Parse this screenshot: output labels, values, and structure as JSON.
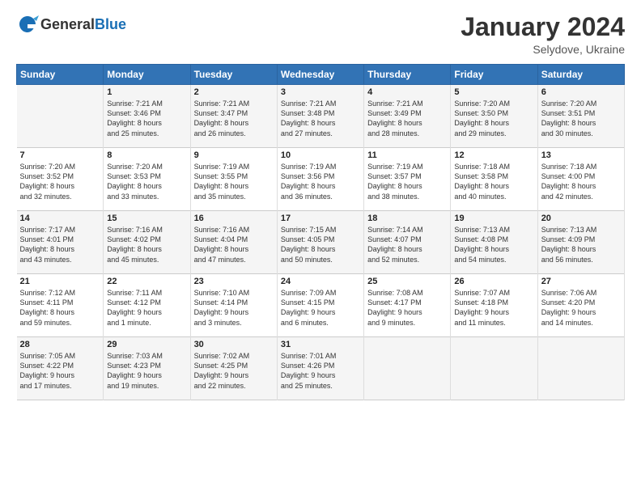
{
  "header": {
    "logo_general": "General",
    "logo_blue": "Blue",
    "month_title": "January 2024",
    "location": "Selydove, Ukraine"
  },
  "days_of_week": [
    "Sunday",
    "Monday",
    "Tuesday",
    "Wednesday",
    "Thursday",
    "Friday",
    "Saturday"
  ],
  "weeks": [
    [
      {
        "day": "",
        "info": ""
      },
      {
        "day": "1",
        "info": "Sunrise: 7:21 AM\nSunset: 3:46 PM\nDaylight: 8 hours\nand 25 minutes."
      },
      {
        "day": "2",
        "info": "Sunrise: 7:21 AM\nSunset: 3:47 PM\nDaylight: 8 hours\nand 26 minutes."
      },
      {
        "day": "3",
        "info": "Sunrise: 7:21 AM\nSunset: 3:48 PM\nDaylight: 8 hours\nand 27 minutes."
      },
      {
        "day": "4",
        "info": "Sunrise: 7:21 AM\nSunset: 3:49 PM\nDaylight: 8 hours\nand 28 minutes."
      },
      {
        "day": "5",
        "info": "Sunrise: 7:20 AM\nSunset: 3:50 PM\nDaylight: 8 hours\nand 29 minutes."
      },
      {
        "day": "6",
        "info": "Sunrise: 7:20 AM\nSunset: 3:51 PM\nDaylight: 8 hours\nand 30 minutes."
      }
    ],
    [
      {
        "day": "7",
        "info": "Sunrise: 7:20 AM\nSunset: 3:52 PM\nDaylight: 8 hours\nand 32 minutes."
      },
      {
        "day": "8",
        "info": "Sunrise: 7:20 AM\nSunset: 3:53 PM\nDaylight: 8 hours\nand 33 minutes."
      },
      {
        "day": "9",
        "info": "Sunrise: 7:19 AM\nSunset: 3:55 PM\nDaylight: 8 hours\nand 35 minutes."
      },
      {
        "day": "10",
        "info": "Sunrise: 7:19 AM\nSunset: 3:56 PM\nDaylight: 8 hours\nand 36 minutes."
      },
      {
        "day": "11",
        "info": "Sunrise: 7:19 AM\nSunset: 3:57 PM\nDaylight: 8 hours\nand 38 minutes."
      },
      {
        "day": "12",
        "info": "Sunrise: 7:18 AM\nSunset: 3:58 PM\nDaylight: 8 hours\nand 40 minutes."
      },
      {
        "day": "13",
        "info": "Sunrise: 7:18 AM\nSunset: 4:00 PM\nDaylight: 8 hours\nand 42 minutes."
      }
    ],
    [
      {
        "day": "14",
        "info": "Sunrise: 7:17 AM\nSunset: 4:01 PM\nDaylight: 8 hours\nand 43 minutes."
      },
      {
        "day": "15",
        "info": "Sunrise: 7:16 AM\nSunset: 4:02 PM\nDaylight: 8 hours\nand 45 minutes."
      },
      {
        "day": "16",
        "info": "Sunrise: 7:16 AM\nSunset: 4:04 PM\nDaylight: 8 hours\nand 47 minutes."
      },
      {
        "day": "17",
        "info": "Sunrise: 7:15 AM\nSunset: 4:05 PM\nDaylight: 8 hours\nand 50 minutes."
      },
      {
        "day": "18",
        "info": "Sunrise: 7:14 AM\nSunset: 4:07 PM\nDaylight: 8 hours\nand 52 minutes."
      },
      {
        "day": "19",
        "info": "Sunrise: 7:13 AM\nSunset: 4:08 PM\nDaylight: 8 hours\nand 54 minutes."
      },
      {
        "day": "20",
        "info": "Sunrise: 7:13 AM\nSunset: 4:09 PM\nDaylight: 8 hours\nand 56 minutes."
      }
    ],
    [
      {
        "day": "21",
        "info": "Sunrise: 7:12 AM\nSunset: 4:11 PM\nDaylight: 8 hours\nand 59 minutes."
      },
      {
        "day": "22",
        "info": "Sunrise: 7:11 AM\nSunset: 4:12 PM\nDaylight: 9 hours\nand 1 minute."
      },
      {
        "day": "23",
        "info": "Sunrise: 7:10 AM\nSunset: 4:14 PM\nDaylight: 9 hours\nand 3 minutes."
      },
      {
        "day": "24",
        "info": "Sunrise: 7:09 AM\nSunset: 4:15 PM\nDaylight: 9 hours\nand 6 minutes."
      },
      {
        "day": "25",
        "info": "Sunrise: 7:08 AM\nSunset: 4:17 PM\nDaylight: 9 hours\nand 9 minutes."
      },
      {
        "day": "26",
        "info": "Sunrise: 7:07 AM\nSunset: 4:18 PM\nDaylight: 9 hours\nand 11 minutes."
      },
      {
        "day": "27",
        "info": "Sunrise: 7:06 AM\nSunset: 4:20 PM\nDaylight: 9 hours\nand 14 minutes."
      }
    ],
    [
      {
        "day": "28",
        "info": "Sunrise: 7:05 AM\nSunset: 4:22 PM\nDaylight: 9 hours\nand 17 minutes."
      },
      {
        "day": "29",
        "info": "Sunrise: 7:03 AM\nSunset: 4:23 PM\nDaylight: 9 hours\nand 19 minutes."
      },
      {
        "day": "30",
        "info": "Sunrise: 7:02 AM\nSunset: 4:25 PM\nDaylight: 9 hours\nand 22 minutes."
      },
      {
        "day": "31",
        "info": "Sunrise: 7:01 AM\nSunset: 4:26 PM\nDaylight: 9 hours\nand 25 minutes."
      },
      {
        "day": "",
        "info": ""
      },
      {
        "day": "",
        "info": ""
      },
      {
        "day": "",
        "info": ""
      }
    ]
  ]
}
